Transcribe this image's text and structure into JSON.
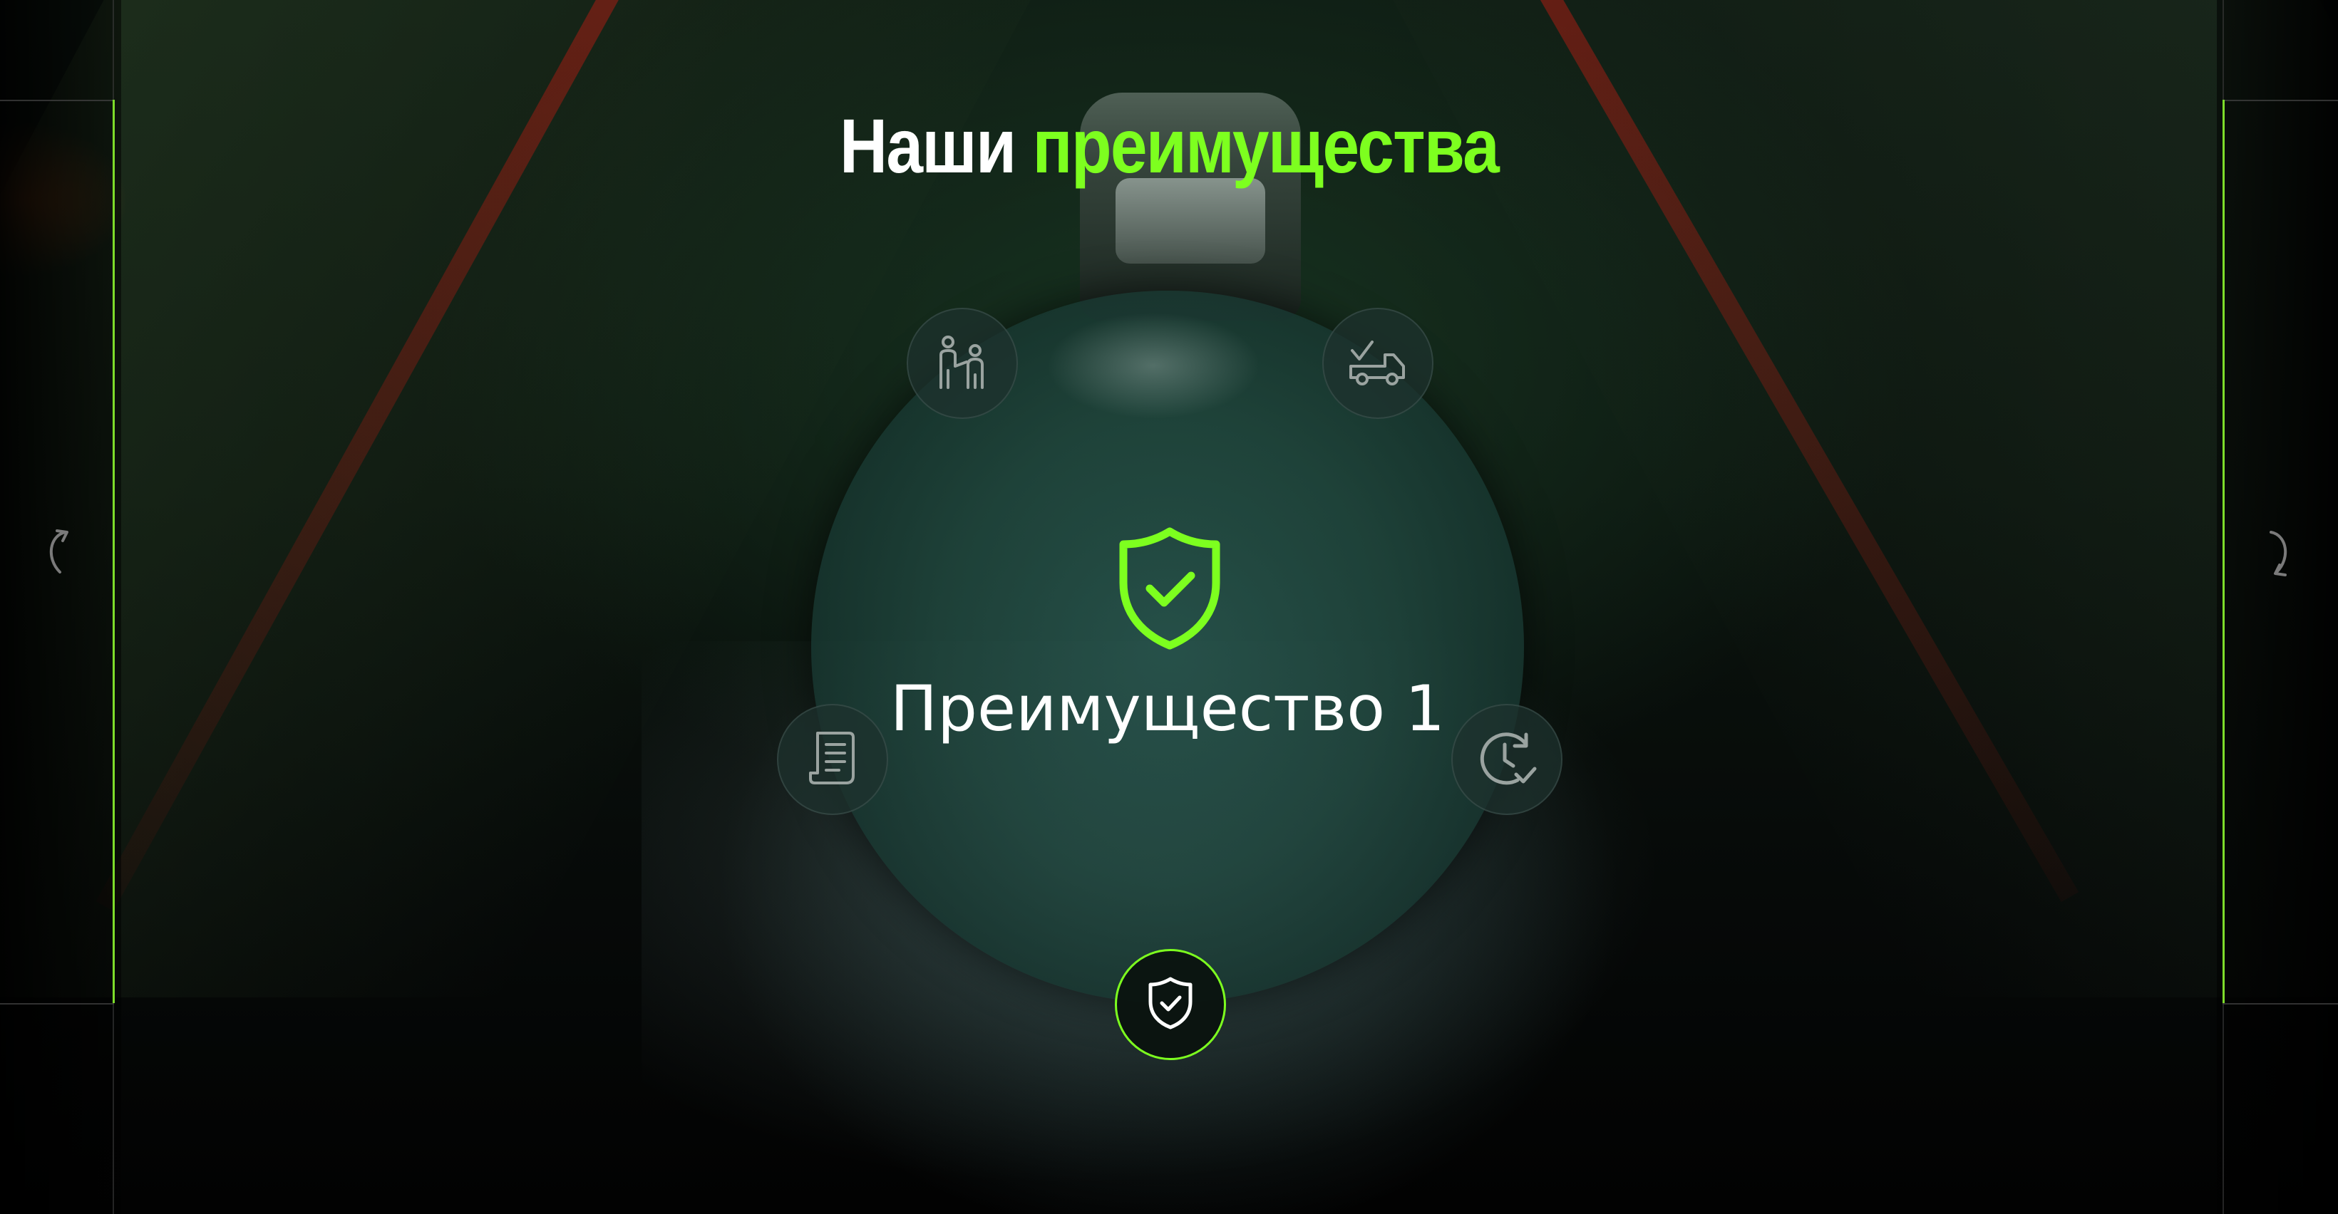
{
  "header": {
    "title_prefix": "Наши",
    "title_accent": "преимущества"
  },
  "feature": {
    "active_label": "Преимущество 1",
    "active_icon": "shield-check-icon"
  },
  "orbit_items": [
    {
      "icon": "people-icon"
    },
    {
      "icon": "truck-check-icon"
    },
    {
      "icon": "document-icon"
    },
    {
      "icon": "clock-check-icon"
    },
    {
      "icon": "shield-check-icon",
      "active": true
    }
  ],
  "navigation": {
    "prev_icon": "arrow-prev-icon",
    "next_icon": "arrow-next-icon"
  },
  "colors": {
    "accent": "#7dff1f",
    "text": "#ffffff",
    "icon_gray": "#9aa3a0"
  }
}
